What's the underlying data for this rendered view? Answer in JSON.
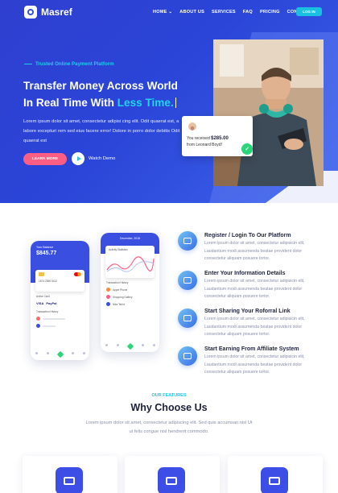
{
  "brand": {
    "name": "Masref"
  },
  "nav": {
    "items": [
      {
        "label": "HOME ⌄"
      },
      {
        "label": "ABOUT US"
      },
      {
        "label": "SERVICES"
      },
      {
        "label": "FAQ"
      },
      {
        "label": "PRICING"
      },
      {
        "label": "CONTACT"
      }
    ],
    "login_label": "LOG IN"
  },
  "hero": {
    "eyebrow": "Trusted Online Payment Platform",
    "headline_line1": "Transfer Money Across World",
    "headline_line2_prefix": "In Real Time With ",
    "headline_line2_accent": "Less Time.",
    "description": "Lorem ipsum dolor sit amet, consectetur adipisi cing elit. Odit quaerat est, a labore excepturi rem sed eius facere error! Dolore in porro dolor debitis Odit quaerat est",
    "learn_more_label": "LEARN MORE",
    "watch_demo_label": "Watch Demo",
    "notification": {
      "line1_prefix": "You received ",
      "amount": "$285.00",
      "line2": "from Leonard Boyd!"
    }
  },
  "phone1": {
    "label": "Your Balance",
    "balance": "$845.77",
    "card_number": "1874    2556    5412",
    "section_active": "Active Card",
    "section_transaction": "Transaction History",
    "payment_brands": [
      "VISA",
      "PayPal"
    ]
  },
  "phone2": {
    "header": "December, 2018",
    "chart_label": "Activity Statistics",
    "section_transaction": "Transaction History",
    "items": [
      "Apple Phone",
      "Shopping Gallery",
      "Nike Tshirt"
    ]
  },
  "features": [
    {
      "title": "Register / Login To Our Platform",
      "description": "Lorem ipsum dolor sit amet, consectetur adipisicin elit, Laudantium modi assumenda beatae provident dolor consectetur aliquam posuere tortor."
    },
    {
      "title": "Enter Your Information Details",
      "description": "Lorem ipsum dolor sit amet, consectetur adipisicin elit, Laudantium modi assumenda beatae provident dolor consectetur aliquam posuere tortor."
    },
    {
      "title": "Start Sharing Your Roforral Link",
      "description": "Lorem ipsum dolor sit amet, consectetur adipisicin elit, Laudantium modi assumenda beatae provident dolor consectetur aliquam posuere tortor."
    },
    {
      "title": "Start Earning From Affiliate System",
      "description": "Lorem ipsum dolor sit amet, consectetur adipisicin elit, Laudantium modi assumenda beatae provident dolor consectetur aliquam posuere tortor."
    }
  ],
  "why": {
    "eyebrow": "OUR FEATURES",
    "title": "Why Choose Us",
    "description": "Lorem ipsum dolor sit amet, consectetur adipiscing elit. Sed quis accumsan nisi Ut ut felis congue nisl hendrerit commodo."
  },
  "colors": {
    "brand_blue": "#3a4ee0",
    "accent_cyan": "#21c3e2",
    "cta_pink": "#ff5e84",
    "success_green": "#2bd67a"
  }
}
